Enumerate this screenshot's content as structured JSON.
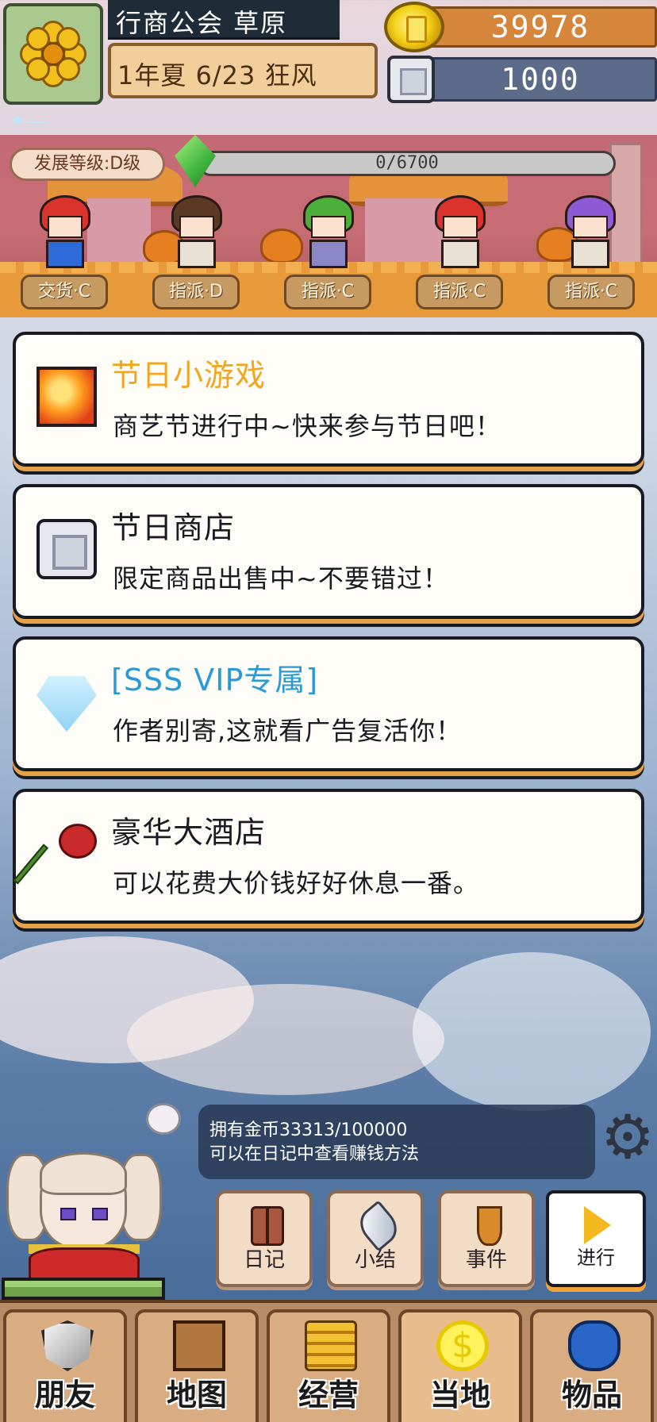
{
  "hud": {
    "guild_title": "行商公会 草原",
    "date": "1年夏 6/23 狂风",
    "gold": "39978",
    "silver": "1000"
  },
  "town": {
    "level_label": "发展等级:D级",
    "exp": "0/6700",
    "staff": [
      {
        "role": "交货·C",
        "hair_color": "#d9332b",
        "outfit_color": "#2f6bd8"
      },
      {
        "role": "指派·D",
        "hair_color": "#5a3a22",
        "outfit_color": "#e8e2d4"
      },
      {
        "role": "指派·C",
        "hair_color": "#4caf3a",
        "outfit_color": "#8a86c8"
      },
      {
        "role": "指派·C",
        "hair_color": "#d9332b",
        "outfit_color": "#e8e2d4"
      },
      {
        "role": "指派·C",
        "hair_color": "#8e5ad6",
        "outfit_color": "#e8e2d4"
      }
    ]
  },
  "cards": [
    {
      "title": "节日小游戏",
      "desc": "商艺节进行中~快来参与节日吧！",
      "title_color": "#f2a51e",
      "icon": "fire-tile-icon"
    },
    {
      "title": "节日商店",
      "desc": "限定商品出售中~不要错过！",
      "title_color": "#1a1a22",
      "icon": "silver-coin-icon"
    },
    {
      "title": "[SSS VIP专属]",
      "desc": "作者别寄,这就看广告复活你！",
      "title_color": "#2a9ad6",
      "icon": "diamond-icon"
    },
    {
      "title": "豪华大酒店",
      "desc": "可以花费大价钱好好休息一番。",
      "title_color": "#1a1a22",
      "icon": "rose-icon"
    }
  ],
  "tip": {
    "line1": "拥有金币33313/100000",
    "line2": "可以在日记中查看赚钱方法"
  },
  "actions": {
    "diary": "日记",
    "summary": "小结",
    "events": "事件",
    "proceed": "进行"
  },
  "nav": {
    "friends": "朋友",
    "map": "地图",
    "business": "经营",
    "local": "当地",
    "items": "物品"
  },
  "colors": {
    "gold_bar": "#d6863a",
    "silver_bar": "#5d6b8a",
    "hp": "#6ea14a"
  }
}
